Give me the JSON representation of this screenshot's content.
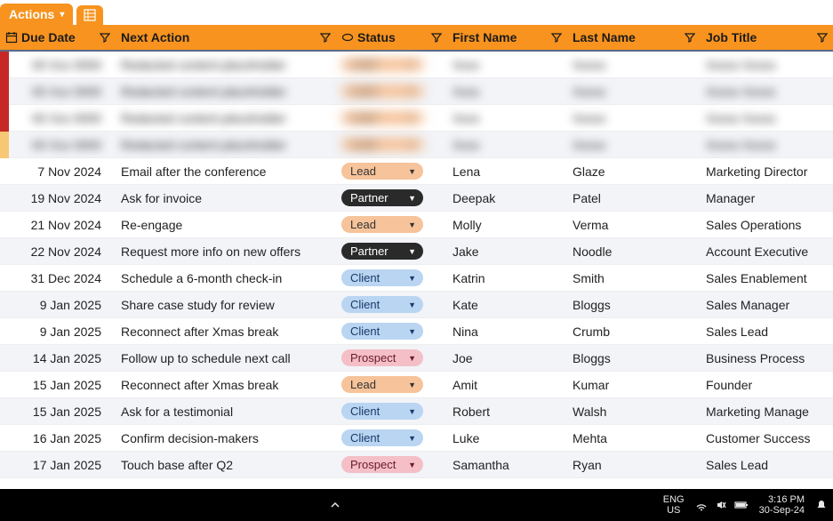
{
  "tab": {
    "actions_label": "Actions"
  },
  "columns": {
    "due": "Due Date",
    "action": "Next Action",
    "status": "Status",
    "first": "First Name",
    "last": "Last Name",
    "job": "Job Title"
  },
  "status_styles": {
    "Lead": "pill-lead",
    "Partner": "pill-partner",
    "Client": "pill-client",
    "Prospect": "pill-prospect"
  },
  "blurred_rows": [
    {
      "strip": "#c62828"
    },
    {
      "strip": "#c62828"
    },
    {
      "strip": "#c62828"
    },
    {
      "strip": "#f7c873"
    }
  ],
  "rows": [
    {
      "due": "7 Nov 2024",
      "action": "Email after the conference",
      "status": "Lead",
      "first": "Lena",
      "last": "Glaze",
      "job": "Marketing Director"
    },
    {
      "due": "19 Nov 2024",
      "action": "Ask for invoice",
      "status": "Partner",
      "first": "Deepak",
      "last": "Patel",
      "job": "Manager"
    },
    {
      "due": "21 Nov 2024",
      "action": "Re-engage",
      "status": "Lead",
      "first": "Molly",
      "last": "Verma",
      "job": "Sales Operations"
    },
    {
      "due": "22 Nov 2024",
      "action": "Request more info on new offers",
      "status": "Partner",
      "first": "Jake",
      "last": "Noodle",
      "job": "Account Executive"
    },
    {
      "due": "31 Dec 2024",
      "action": "Schedule a 6-month check-in",
      "status": "Client",
      "first": "Katrin",
      "last": "Smith",
      "job": "Sales Enablement"
    },
    {
      "due": "9 Jan 2025",
      "action": "Share case study for review",
      "status": "Client",
      "first": "Kate",
      "last": "Bloggs",
      "job": "Sales Manager"
    },
    {
      "due": "9 Jan 2025",
      "action": "Reconnect after Xmas break",
      "status": "Client",
      "first": "Nina",
      "last": "Crumb",
      "job": "Sales Lead"
    },
    {
      "due": "14 Jan 2025",
      "action": "Follow up to schedule next call",
      "status": "Prospect",
      "first": "Joe",
      "last": "Bloggs",
      "job": "Business Process"
    },
    {
      "due": "15 Jan 2025",
      "action": "Reconnect after Xmas break",
      "status": "Lead",
      "first": "Amit",
      "last": "Kumar",
      "job": "Founder"
    },
    {
      "due": "15 Jan 2025",
      "action": "Ask for a testimonial",
      "status": "Client",
      "first": "Robert",
      "last": "Walsh",
      "job": "Marketing Manage"
    },
    {
      "due": "16 Jan 2025",
      "action": "Confirm decision-makers",
      "status": "Client",
      "first": "Luke",
      "last": "Mehta",
      "job": "Customer Success"
    },
    {
      "due": "17 Jan 2025",
      "action": "Touch base after Q2",
      "status": "Prospect",
      "first": "Samantha",
      "last": "Ryan",
      "job": "Sales Lead"
    }
  ],
  "taskbar": {
    "lang_top": "ENG",
    "lang_bot": "US",
    "time": "3:16 PM",
    "date": "30-Sep-24"
  }
}
